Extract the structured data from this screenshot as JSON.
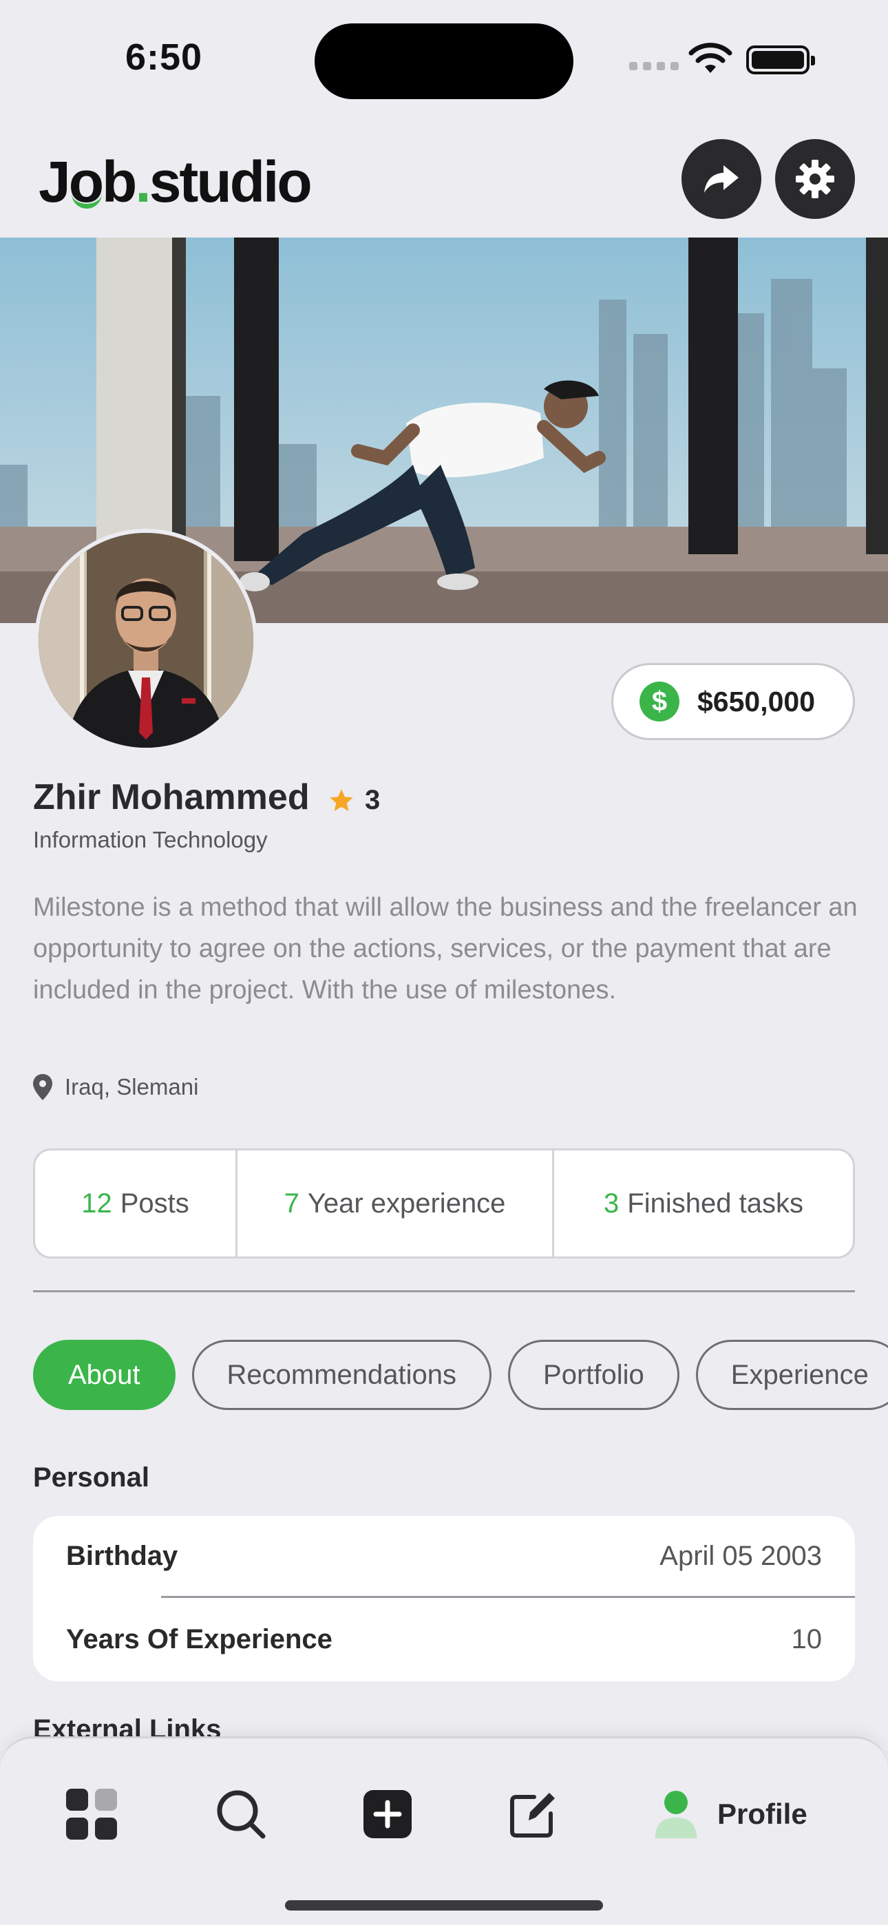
{
  "status_bar": {
    "time": "6:50"
  },
  "header": {
    "logo_part1": "J",
    "logo_o": "o",
    "logo_part2": "b",
    "logo_dot": ".",
    "logo_part3": "studio",
    "share_icon": "share-icon",
    "settings_icon": "gear-icon"
  },
  "profile": {
    "balance": "$650,000",
    "balance_icon_glyph": "$",
    "name": "Zhir Mohammed",
    "rating": "3",
    "role": "Information Technology",
    "bio": "Milestone is a method that will allow the business and the freelancer an opportunity to agree on the actions, services, or the payment that are included in the project. With the use of milestones.",
    "location": "Iraq, Slemani"
  },
  "stats": [
    {
      "num": "12",
      "label": "Posts"
    },
    {
      "num": "7",
      "label": "Year experience"
    },
    {
      "num": "3",
      "label": "Finished tasks"
    }
  ],
  "tabs": [
    {
      "label": "About",
      "active": true
    },
    {
      "label": "Recommendations",
      "active": false
    },
    {
      "label": "Portfolio",
      "active": false
    },
    {
      "label": "Experience",
      "active": false
    }
  ],
  "personal": {
    "title": "Personal",
    "rows": [
      {
        "key": "Birthday",
        "value": "April 05 2003"
      },
      {
        "key": "Years Of Experience",
        "value": "10"
      }
    ]
  },
  "external_links_title": "External Links",
  "tabbar": {
    "profile_label": "Profile"
  },
  "colors": {
    "accent": "#3BB54A",
    "background": "#ECECF1",
    "dark": "#2A2A2C",
    "star": "#F5A623"
  }
}
